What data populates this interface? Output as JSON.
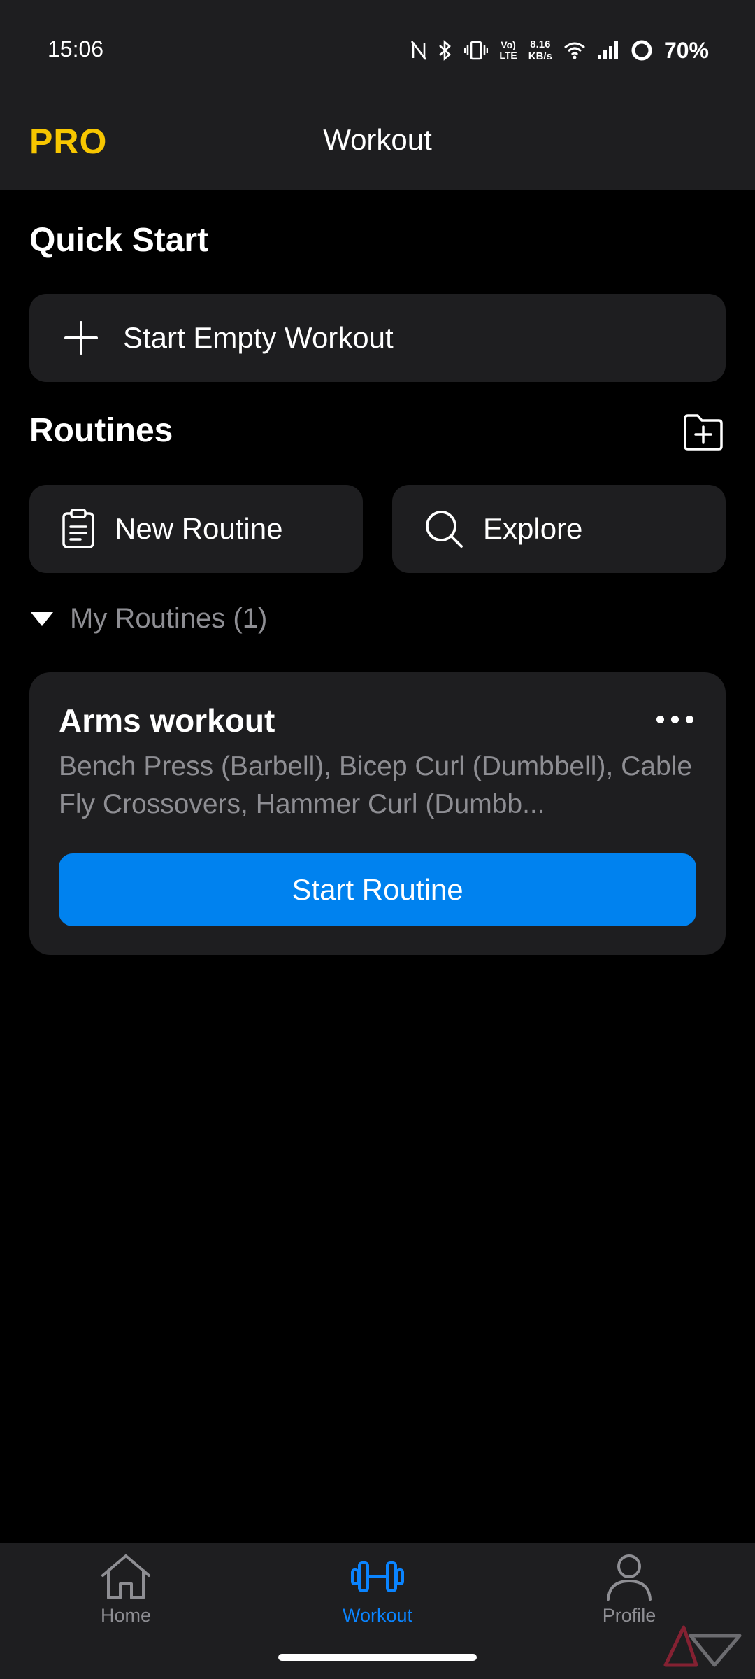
{
  "status_bar": {
    "time": "15:06",
    "volte_top": "Vo)",
    "volte_bottom": "LTE",
    "net_speed_value": "8.16",
    "net_speed_unit": "KB/s",
    "battery": "70%"
  },
  "header": {
    "pro_label": "PRO",
    "title": "Workout"
  },
  "quick_start": {
    "title": "Quick Start",
    "start_empty_label": "Start Empty Workout"
  },
  "routines": {
    "title": "Routines",
    "new_routine_label": "New Routine",
    "explore_label": "Explore",
    "my_routines_label": "My Routines (1)",
    "items": [
      {
        "name": "Arms workout",
        "exercises": "Bench Press (Barbell), Bicep Curl (Dumbbell), Cable Fly Crossovers, Hammer Curl (Dumbb...",
        "start_label": "Start Routine"
      }
    ]
  },
  "bottom_nav": {
    "home": "Home",
    "workout": "Workout",
    "profile": "Profile",
    "active": "workout",
    "active_color": "#0a84ff"
  },
  "colors": {
    "pro": "#f7c600",
    "primary_button": "#0082ef",
    "surface": "#1e1e20",
    "muted_text": "#8e8e93"
  }
}
